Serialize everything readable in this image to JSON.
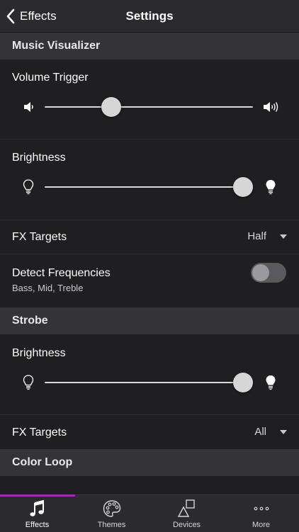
{
  "nav": {
    "back_label": "Effects",
    "title": "Settings"
  },
  "music_visualizer": {
    "header": "Music Visualizer",
    "volume_trigger": {
      "label": "Volume Trigger",
      "value_pct": 30
    },
    "brightness": {
      "label": "Brightness",
      "value_pct": 100
    },
    "fx_targets": {
      "label": "FX Targets",
      "value": "Half"
    },
    "detect_frequencies": {
      "label": "Detect Frequencies",
      "sublabel": "Bass, Mid, Treble",
      "enabled": false
    }
  },
  "strobe": {
    "header": "Strobe",
    "brightness": {
      "label": "Brightness",
      "value_pct": 100
    },
    "fx_targets": {
      "label": "FX Targets",
      "value": "All"
    }
  },
  "color_loop": {
    "header": "Color Loop"
  },
  "tabs": [
    {
      "label": "Effects",
      "icon": "music-note-icon",
      "active": true
    },
    {
      "label": "Themes",
      "icon": "palette-icon",
      "active": false
    },
    {
      "label": "Devices",
      "icon": "shapes-icon",
      "active": false
    },
    {
      "label": "More",
      "icon": "ellipsis-icon",
      "active": false
    }
  ],
  "colors": {
    "accent": "#9b2fae",
    "background": "#1f1f21",
    "header": "#343437",
    "bar": "#2b2b2e"
  }
}
